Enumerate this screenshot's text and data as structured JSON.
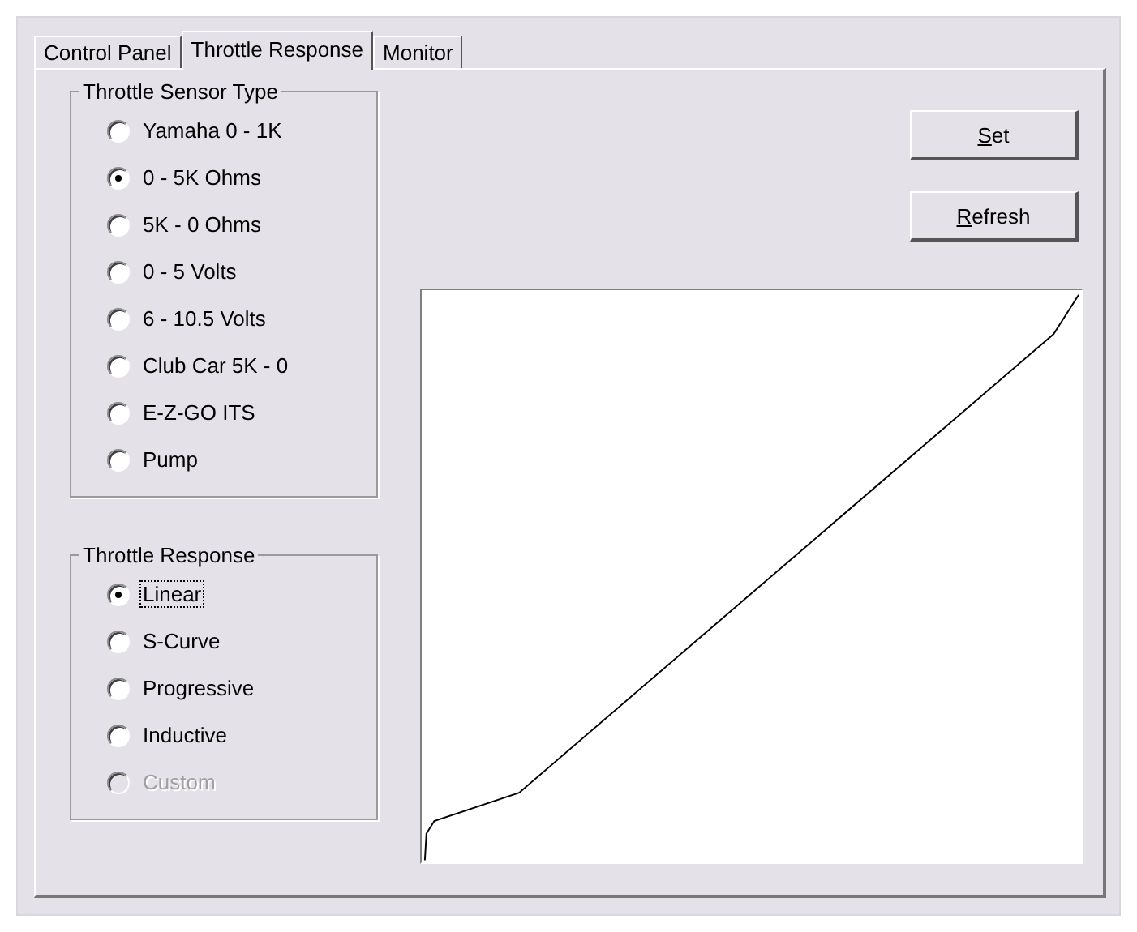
{
  "tabs": [
    {
      "label": "Control Panel",
      "selected": false
    },
    {
      "label": "Throttle Response",
      "selected": true
    },
    {
      "label": "Monitor",
      "selected": false
    }
  ],
  "sensor_group": {
    "title": "Throttle Sensor Type",
    "options": [
      {
        "label": "Yamaha 0 - 1K",
        "selected": false,
        "disabled": false,
        "focused": false
      },
      {
        "label": "0 - 5K Ohms",
        "selected": true,
        "disabled": false,
        "focused": false
      },
      {
        "label": "5K - 0 Ohms",
        "selected": false,
        "disabled": false,
        "focused": false
      },
      {
        "label": "0 - 5 Volts",
        "selected": false,
        "disabled": false,
        "focused": false
      },
      {
        "label": "6 - 10.5 Volts",
        "selected": false,
        "disabled": false,
        "focused": false
      },
      {
        "label": "Club Car 5K - 0",
        "selected": false,
        "disabled": false,
        "focused": false
      },
      {
        "label": "E-Z-GO ITS",
        "selected": false,
        "disabled": false,
        "focused": false
      },
      {
        "label": "Pump",
        "selected": false,
        "disabled": false,
        "focused": false
      }
    ]
  },
  "response_group": {
    "title": "Throttle Response",
    "options": [
      {
        "label": "Linear",
        "selected": true,
        "disabled": false,
        "focused": true
      },
      {
        "label": "S-Curve",
        "selected": false,
        "disabled": false,
        "focused": false
      },
      {
        "label": "Progressive",
        "selected": false,
        "disabled": false,
        "focused": false
      },
      {
        "label": "Inductive",
        "selected": false,
        "disabled": false,
        "focused": false
      },
      {
        "label": "Custom",
        "selected": false,
        "disabled": true,
        "focused": false
      }
    ]
  },
  "buttons": [
    {
      "label": "Set"
    },
    {
      "label": "Refresh"
    }
  ]
}
